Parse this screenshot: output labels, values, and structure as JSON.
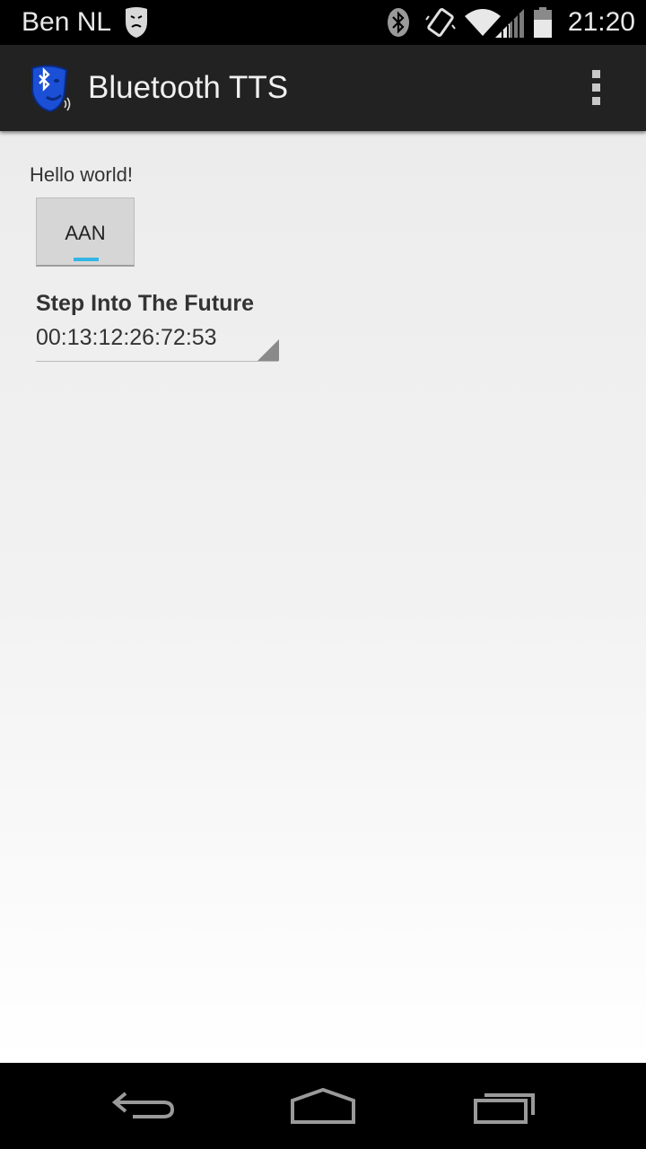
{
  "status_bar": {
    "carrier": "Ben NL",
    "time": "21:20",
    "icons": [
      "mask-notification-icon",
      "bluetooth-icon",
      "vibrate-icon",
      "wifi-icon",
      "cell-signal-icon",
      "battery-icon"
    ]
  },
  "action_bar": {
    "title": "Bluetooth TTS",
    "app_icon": "bluetooth-face-icon",
    "overflow_icon": "overflow-menu-icon"
  },
  "main": {
    "hello_text": "Hello world!",
    "toggle_label": "AAN",
    "device": {
      "name": "Step Into The Future",
      "address": "00:13:12:26:72:53"
    }
  },
  "nav_bar": {
    "icons": [
      "back-icon",
      "home-icon",
      "recents-icon"
    ]
  },
  "colors": {
    "accent": "#33b5e5",
    "action_bar": "#222222",
    "app_icon_blue": "#1a4fd6"
  }
}
